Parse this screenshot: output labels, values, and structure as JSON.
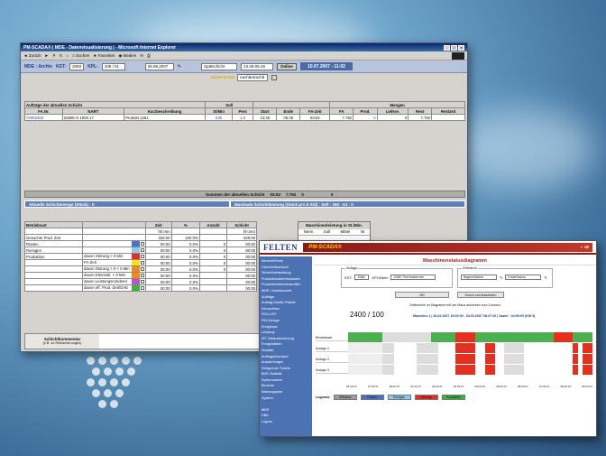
{
  "main_window": {
    "title": "PM-SCADA® | MDE - Datenvisualisierung | - Microsoft Internet Explorer",
    "toolbar": {
      "back": "Zurück",
      "search": "Suchen",
      "favorites": "Favoriten",
      "media": "Medien"
    },
    "header": {
      "mde_label": "MDE : Archiv",
      "kst_label": "KST:",
      "kst_value": "2083",
      "kpl_label": "KPL:",
      "kpl_value": "108 / 01",
      "date": "26.06.2007",
      "shift": "Spätschicht",
      "time": "13.45-05.45",
      "online_btn": "Online",
      "datetime": "10.07.2007 - 11:02"
    },
    "subfilter": {
      "label": "Einzel Monat",
      "value": "nachbetrachtt"
    },
    "orders": {
      "section_title": "Aufträge der aktuellen Schicht",
      "soll_header": "Soll",
      "mengen_header": "Mengen",
      "columns": [
        "FA.Nr.",
        "NART",
        "Kurzbeschreibung",
        "St/Min",
        "Pers",
        "Start",
        "Ende",
        "FA-Zeit",
        "FA",
        "Prod.",
        "Liefere.",
        "Rest",
        "Restzeit"
      ],
      "row": [
        "72003403",
        "02808 O 1800 17",
        "Produkt 1281",
        "230",
        "1,0",
        "13:45",
        "05:45",
        "03:52",
        "7.792",
        "0",
        "0",
        "7.792",
        ""
      ]
    },
    "summary": {
      "label": "Summen der aktuellen Schicht",
      "time": "03:52",
      "fa": "7.792",
      "prod": "0",
      "liefere": "0"
    },
    "bars": {
      "left": "Aktuelle Schichtmenge (Stück) : 0",
      "right": "Maximale Schichtleistung (Stück pro 8 Std) : Soll : 350 - Ist : 0"
    },
    "betrieb": {
      "title": "Betriebsart",
      "col_zeit": "Zeit",
      "col_pct": "%",
      "col_anzahl": "Anzahl",
      "col_schicht": "Schicht",
      "unit": "hh:mm",
      "rows": [
        {
          "label": "Gesuchte Prod. Zeit",
          "sub": "",
          "zeit": "328:00",
          "pct": "100.0%",
          "anz": "",
          "color": ""
        },
        {
          "label": "Rüsten",
          "sub": "",
          "zeit": "00:00",
          "pct": "0.0%",
          "anz": "0",
          "color": "#4a73c8"
        },
        {
          "label": "Reinigen",
          "sub": "",
          "zeit": "00:00",
          "pct": "0.0%",
          "anz": "0",
          "color": "#8fc7e6"
        },
        {
          "label": "Produktion",
          "sub": "davon Störung > 0 Min",
          "zeit": "00:00",
          "pct": "0.0%",
          "anz": "0",
          "color": "#e53020"
        },
        {
          "label": "",
          "sub": "FA-Zeit",
          "zeit": "00:00",
          "pct": "0.0%",
          "anz": "0",
          "color": "#f2e31a"
        },
        {
          "label": "",
          "sub": "davon Störung > 0 < 0 Min",
          "zeit": "00:00",
          "pct": "0.0%",
          "anz": "0",
          "color": "#f08a1c"
        },
        {
          "label": "",
          "sub": "davon Kleinstör. < 0 Min",
          "zeit": "00:00",
          "pct": "0.0%",
          "anz": "",
          "color": "#f08a1c"
        },
        {
          "label": "",
          "sub": "davon Leistungsminderer",
          "zeit": "00:00",
          "pct": "0.0%",
          "anz": "",
          "color": "#c44fc4"
        },
        {
          "label": "",
          "sub": "davon eff. Prod.-Zeit/OAE",
          "zeit": "00:00",
          "pct": "0.0%",
          "anz": "",
          "color": "#3ab53a"
        }
      ]
    },
    "machine": {
      "title": "Maschinenleistung in St./Min.",
      "cols": [
        "Nenn",
        "Soll",
        "Mittel",
        "Ist"
      ]
    },
    "comment": {
      "title": "Schichtkommentar",
      "sub": "(z.B. zu Reklamierungen)"
    }
  },
  "second_window": {
    "logo": "FELTEN",
    "product": "PM-SCADA®",
    "title": "Maschinenstatusdiagramm",
    "nav": [
      "Intranet/Home",
      "Übersichtsansicht",
      "Schichtbetrachtung",
      "Produktionsbetriebsdaten",
      "Produktionsbetriebsmittel",
      "MDE / Arbeitsschritt",
      "Aufträge",
      "Auftrag Details Pakete",
      "Kennzahlen",
      "SOLL/IST",
      "PM-Vorlage",
      "Ereignisse",
      "Leistung",
      "IST Zeitaufzeichnung",
      "Ereignislisten",
      "Statistik",
      "Auftragsübersicht",
      "Auswertungen",
      "Störgründe Tickets",
      "BDE-Statistik",
      "Systemadmin",
      "Berichte",
      "Wartungsplan",
      "System",
      "",
      "MDE",
      "Hilfe",
      "Logout"
    ],
    "filter": {
      "legend": "Anlage",
      "kst": "KST:",
      "kst_value": "2080",
      "kpl": "KPL/Bahn",
      "kpl_value": "2080 Thermoformer",
      "zeit_legend": "Zeitraum",
      "from": "Beginn/Datum",
      "to": "Ende/Datum"
    },
    "ok_button": "OK",
    "reset_button": "Zoom zurücksetzen",
    "hint": "Zeitbereich im Diagramm mit der Maus aufziehen zum Zoomen",
    "counter": "2400 / 100",
    "range_text": "Maschine 1 | 26.02.2007 15:00:00 - 03.03.2007 08:37:00 | Dauer : 04:00:00 (KW 9)",
    "rows": [
      "Betriebsart",
      "Anlage 1",
      "Anlage 2",
      "Anlage 3"
    ],
    "time_labels": [
      "26.02.07",
      "27.02.07",
      "28.02.07",
      "01.03.07",
      "02.03.07",
      "03.03.07",
      "04.03.07",
      "05.03.07",
      "06.03.07",
      "07.03.07",
      "08.03.07",
      "09.03.07"
    ],
    "legend": {
      "label": "Legende",
      "items": [
        "Stillstand",
        "Rüsten",
        "Reinigen",
        "Störung",
        "Produktion"
      ]
    }
  }
}
